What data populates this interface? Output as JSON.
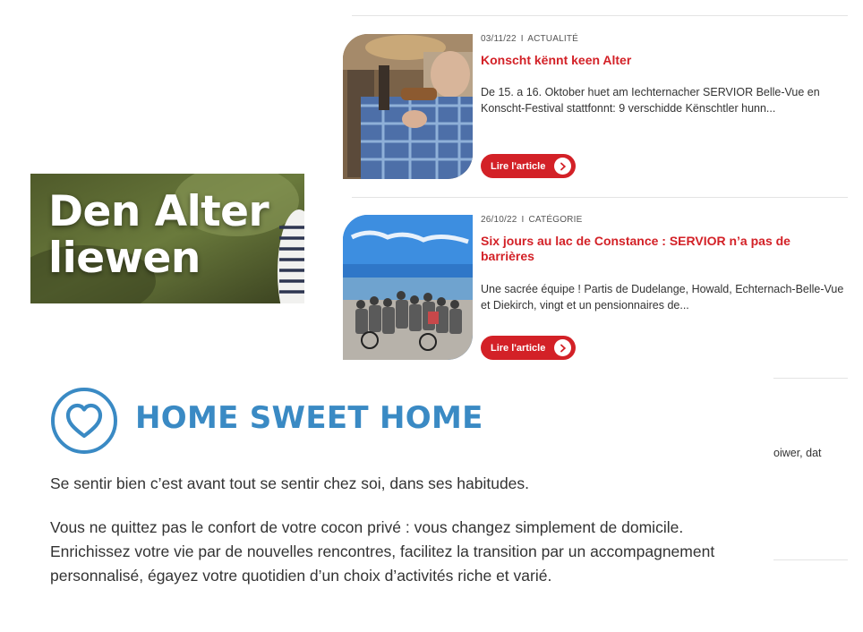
{
  "articles": [
    {
      "date": "03/11/22",
      "separator": "I",
      "category": "ACTUALITÉ",
      "title": "Konscht kënnt keen Alter",
      "excerpt": "De 15. a 16. Oktober huet am Iechternacher SERVIOR Belle-Vue en Konscht-Festival stattfonnt: 9 verschidde Kënschtler hunn...",
      "button": "Lire l'article"
    },
    {
      "date": "26/10/22",
      "separator": "I",
      "category": "CATÉGORIE",
      "title": "Six jours au lac de Constance : SERVIOR n’a pas de barrières",
      "excerpt": "Une sacrée équipe ! Partis de Dudelange, Howald, Echternach-Belle-Vue et Diekirch, vingt et un pensionnaires de...",
      "button": "Lire l'article"
    }
  ],
  "banner": {
    "line1": "Den Alter",
    "line2": "liewen"
  },
  "home": {
    "icon": "heart-circle-icon",
    "title": "HOME SWEET HOME",
    "paragraph1": "Se sentir bien c’est avant tout se sentir chez soi, dans ses habitudes.",
    "paragraph2": "Vous ne quittez pas le confort de votre cocon privé : vous changez simplement de domicile. Enrichissez votre vie par de nouvelles rencontres, facilitez la transition par un accompagnement personnalisé, égayez votre quotidien d’un choix d’activités riche et varié."
  },
  "clipped_text": "oiwer, dat",
  "colors": {
    "accent_red": "#d32127",
    "accent_blue": "#3a8ac4",
    "divider": "#e4e4e4"
  },
  "icons": {
    "read_more": "chevron-right-icon"
  }
}
